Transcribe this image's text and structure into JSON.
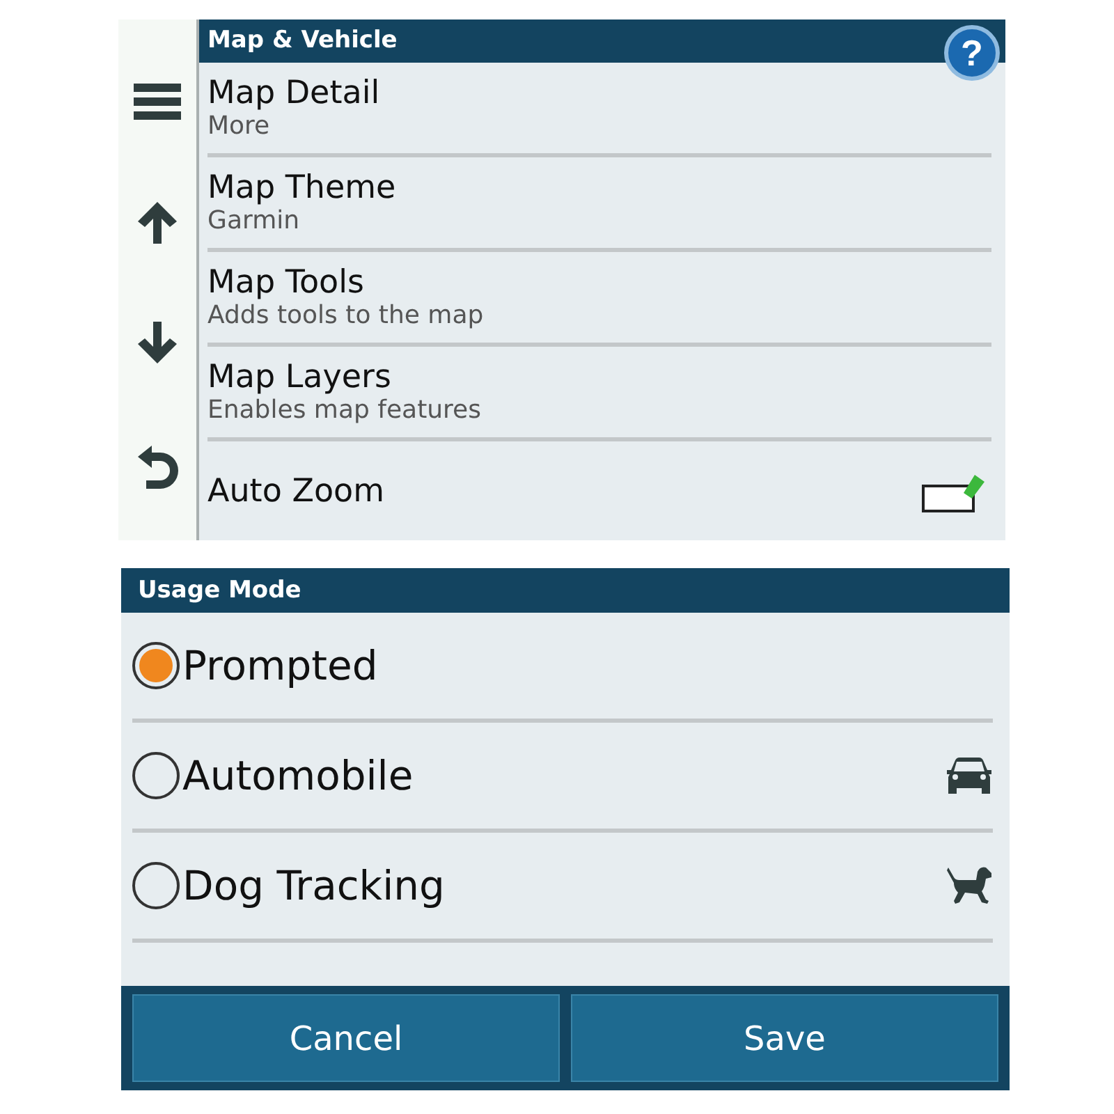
{
  "settings_panel": {
    "title": "Map & Vehicle",
    "help_button": "?",
    "items": [
      {
        "title": "Map Detail",
        "subtitle": "More",
        "kind": "link"
      },
      {
        "title": "Map Theme",
        "subtitle": "Garmin",
        "kind": "link"
      },
      {
        "title": "Map Tools",
        "subtitle": "Adds tools to the map",
        "kind": "link"
      },
      {
        "title": "Map Layers",
        "subtitle": "Enables map features",
        "kind": "link"
      },
      {
        "title": "Auto Zoom",
        "kind": "checkbox",
        "checked": true
      }
    ]
  },
  "dialog": {
    "title": "Usage Mode",
    "options": [
      {
        "label": "Prompted",
        "selected": true,
        "kind": "none"
      },
      {
        "label": "Automobile",
        "selected": false,
        "kind": "car"
      },
      {
        "label": "Dog Tracking",
        "selected": false,
        "kind": "dog"
      }
    ],
    "buttons": [
      "Cancel",
      "Save"
    ]
  }
}
